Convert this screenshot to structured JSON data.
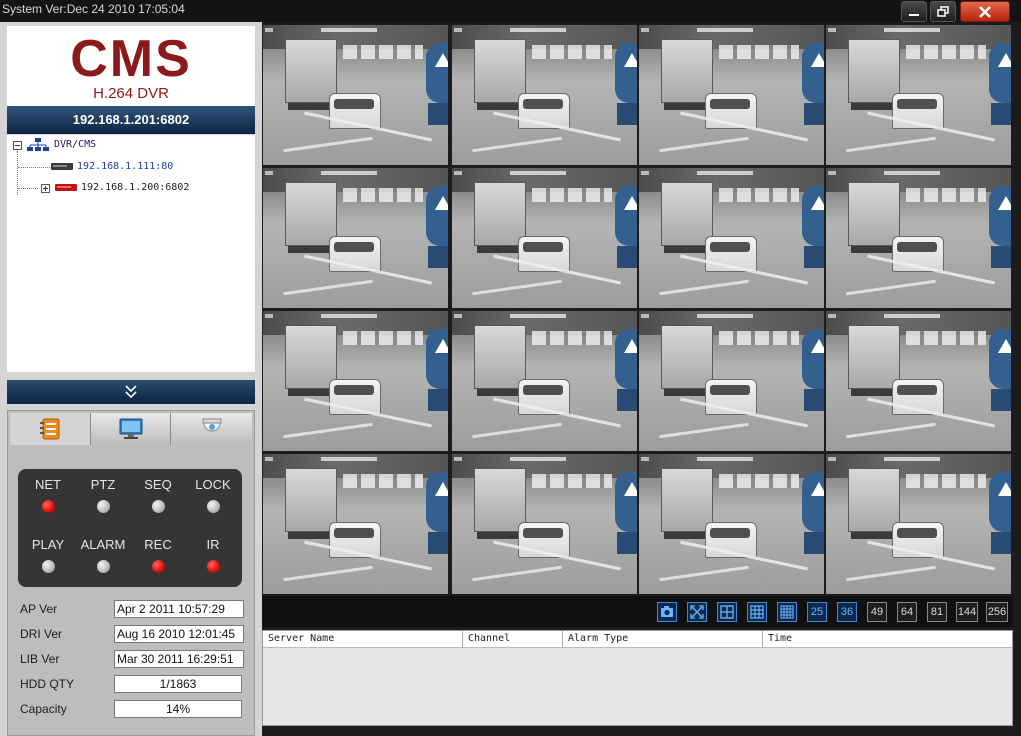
{
  "window": {
    "title": "System Ver:Dec 24 2010 17:05:04"
  },
  "logo": {
    "brand": "CMS",
    "subtitle": "H.264 DVR"
  },
  "connection": {
    "address": "192.168.1.201:6802"
  },
  "device_tree": {
    "root_label": "DVR/CMS",
    "devices": [
      {
        "label": "192.168.1.111:80"
      },
      {
        "label": "192.168.1.200:6802"
      }
    ]
  },
  "status_indicators": [
    {
      "label": "NET",
      "state": "on"
    },
    {
      "label": "PTZ",
      "state": "off"
    },
    {
      "label": "SEQ",
      "state": "off"
    },
    {
      "label": "LOCK",
      "state": "off"
    },
    {
      "label": "PLAY",
      "state": "off"
    },
    {
      "label": "ALARM",
      "state": "off"
    },
    {
      "label": "REC",
      "state": "on"
    },
    {
      "label": "IR",
      "state": "on"
    }
  ],
  "info": {
    "ap_ver": {
      "label": "AP  Ver",
      "value": "Apr  2 2011 10:57:29"
    },
    "dri_ver": {
      "label": "DRI  Ver",
      "value": "Aug 16 2010 12:01:45"
    },
    "lib_ver": {
      "label": "LIB Ver",
      "value": "Mar 30 2011 16:29:51"
    },
    "hdd_qty": {
      "label": "HDD QTY",
      "value": "1/1863"
    },
    "capacity": {
      "label": "Capacity",
      "value": "14%"
    }
  },
  "toolbar": {
    "layouts": [
      "25",
      "36",
      "49",
      "64",
      "81",
      "144",
      "256"
    ]
  },
  "alarm_table": {
    "columns": [
      "Server Name",
      "Channel",
      "Alarm Type",
      "Time"
    ]
  },
  "colors": {
    "led_on": "#d80e0e",
    "led_off": "#b8b8b8",
    "brand": "#8c1a1a",
    "accent_blue": "#3c86d8"
  }
}
